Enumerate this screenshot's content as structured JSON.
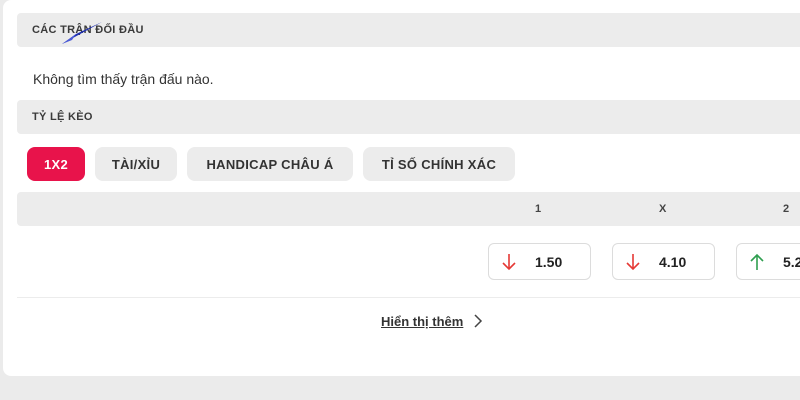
{
  "head_to_head": {
    "title": "CÁC TRẬN ĐỐI ĐẦU",
    "empty_message": "Không tìm thấy trận đấu nào."
  },
  "odds": {
    "title": "TỶ LỆ KÈO",
    "tabs": [
      {
        "label": "1X2",
        "active": true
      },
      {
        "label": "TÀI/XỈU",
        "active": false
      },
      {
        "label": "HANDICAP CHÂU Á",
        "active": false
      },
      {
        "label": "TỈ SỐ CHÍNH XÁC",
        "active": false
      }
    ],
    "columns": [
      "1",
      "X",
      "2"
    ],
    "values": [
      {
        "value": "1.50",
        "trend": "down",
        "icon": "arrow-down-icon"
      },
      {
        "value": "4.10",
        "trend": "down",
        "icon": "arrow-down-icon"
      },
      {
        "value": "5.2",
        "trend": "up",
        "icon": "arrow-up-icon"
      }
    ]
  },
  "show_more_label": "Hiển thị thêm",
  "colors": {
    "accent": "#e8134b",
    "down": "#e53935",
    "up": "#2e9e4f",
    "header_bg": "#ececec"
  }
}
